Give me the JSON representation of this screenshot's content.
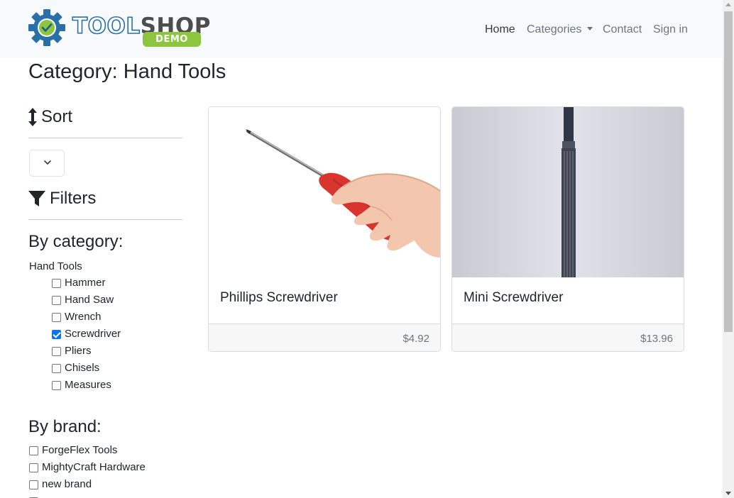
{
  "brand": {
    "name_part1": "TOOL",
    "name_part2": "SHOP",
    "badge": "DEMO"
  },
  "nav": {
    "home": "Home",
    "categories": "Categories",
    "contact": "Contact",
    "signin": "Sign in"
  },
  "page": {
    "title": "Category: Hand Tools"
  },
  "sidebar": {
    "sort_heading": "Sort",
    "filters_heading": "Filters",
    "by_category_heading": "By category:",
    "category_parent": "Hand Tools",
    "categories": [
      {
        "label": "Hammer",
        "checked": false
      },
      {
        "label": "Hand Saw",
        "checked": false
      },
      {
        "label": "Wrench",
        "checked": false
      },
      {
        "label": "Screwdriver",
        "checked": true
      },
      {
        "label": "Pliers",
        "checked": false
      },
      {
        "label": "Chisels",
        "checked": false
      },
      {
        "label": "Measures",
        "checked": false
      }
    ],
    "by_brand_heading": "By brand:",
    "brands": [
      {
        "label": "ForgeFlex Tools",
        "checked": false
      },
      {
        "label": "MightyCraft Hardware",
        "checked": false
      },
      {
        "label": "new brand",
        "checked": false
      }
    ]
  },
  "products": [
    {
      "name": "Phillips Screwdriver",
      "price": "$4.92"
    },
    {
      "name": "Mini Screwdriver",
      "price": "$13.96"
    }
  ],
  "colors": {
    "brand_blue": "#2a70a8",
    "brand_green": "#8cc63f",
    "checkbox_checked": "#0075ff"
  }
}
